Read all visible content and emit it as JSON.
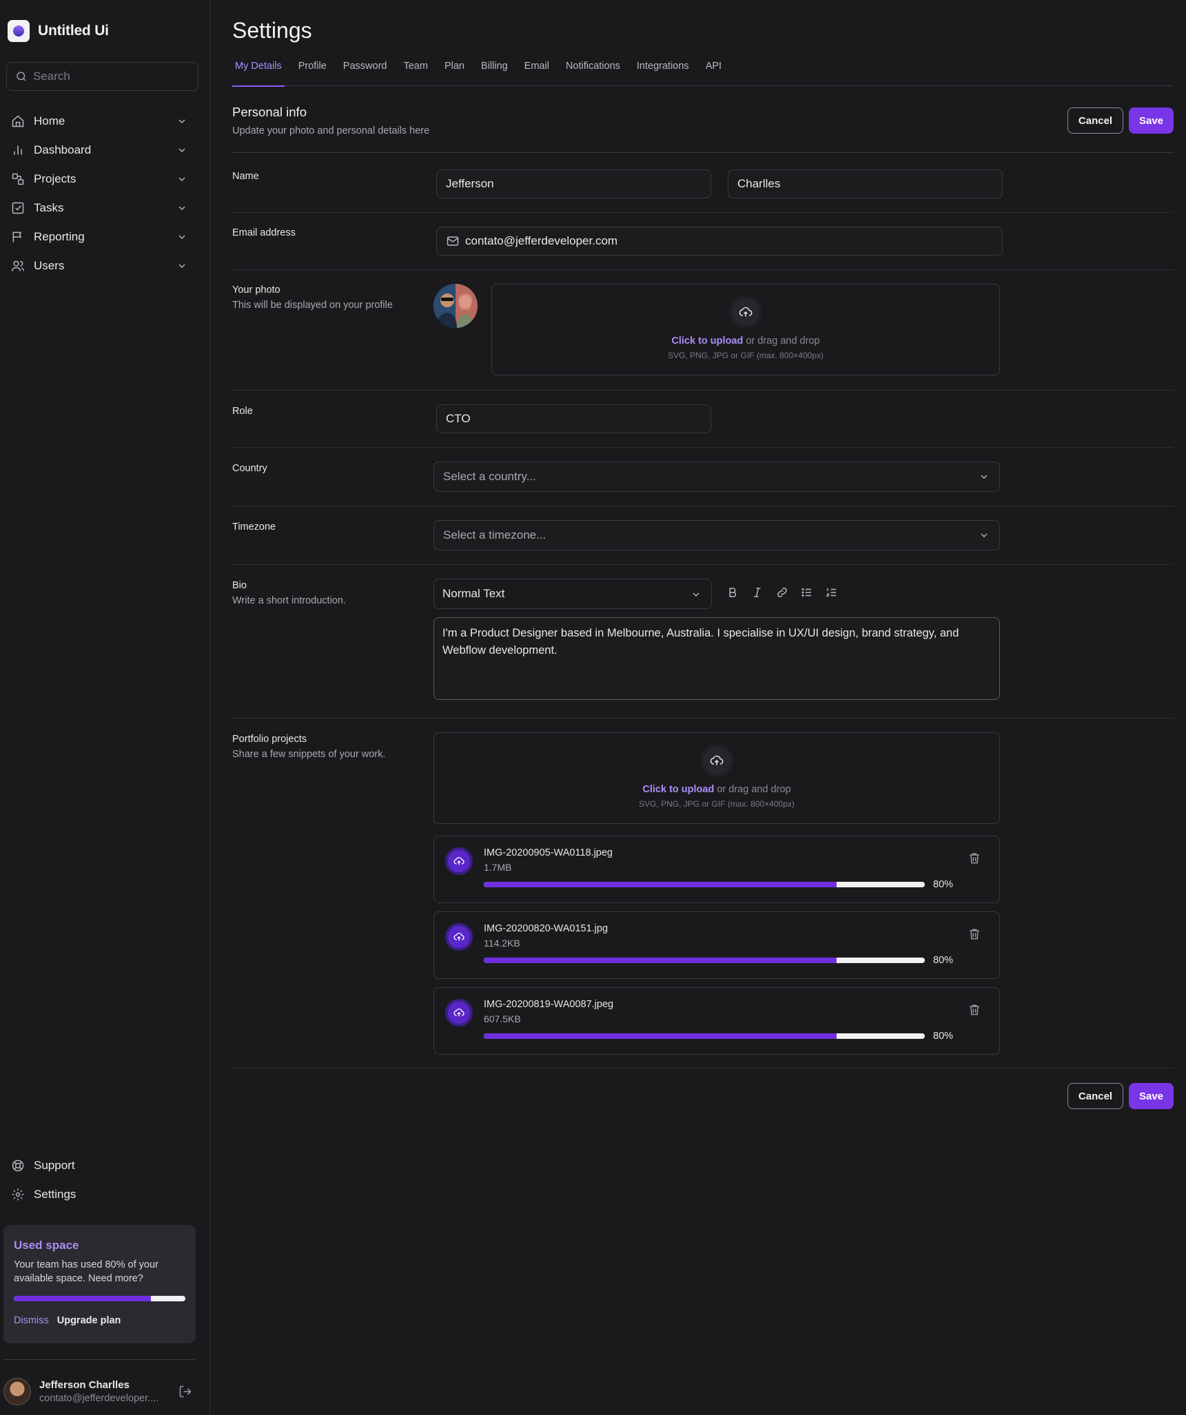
{
  "app": {
    "name": "Untitled Ui"
  },
  "search": {
    "placeholder": "Search"
  },
  "sidebar": {
    "items": [
      {
        "label": "Home",
        "icon": "home-icon"
      },
      {
        "label": "Dashboard",
        "icon": "bar-chart-icon"
      },
      {
        "label": "Projects",
        "icon": "layers-icon"
      },
      {
        "label": "Tasks",
        "icon": "check-square-icon"
      },
      {
        "label": "Reporting",
        "icon": "flag-icon"
      },
      {
        "label": "Users",
        "icon": "users-icon"
      }
    ],
    "bottom": [
      {
        "label": "Support",
        "icon": "lifebuoy-icon"
      },
      {
        "label": "Settings",
        "icon": "gear-icon"
      }
    ]
  },
  "used_space": {
    "title": "Used space",
    "text": "Your team has used 80% of your available space. Need more?",
    "progress": 0.8,
    "dismiss": "Dismiss",
    "upgrade": "Upgrade plan"
  },
  "user": {
    "name": "Jefferson Charlles",
    "email": "contato@jefferdeveloper...."
  },
  "page": {
    "title": "Settings"
  },
  "tabs": [
    "My Details",
    "Profile",
    "Password",
    "Team",
    "Plan",
    "Billing",
    "Email",
    "Notifications",
    "Integrations",
    "API"
  ],
  "personal": {
    "title": "Personal info",
    "subtitle": "Update your photo and personal details here",
    "cancel": "Cancel",
    "save": "Save"
  },
  "form": {
    "name_label": "Name",
    "first_name": "Jefferson",
    "last_name": "Charlles",
    "email_label": "Email address",
    "email": "contato@jefferdeveloper.com",
    "photo_label": "Your photo",
    "photo_sub": "This will be displayed on your profile",
    "upload_cta": "Click to upload",
    "upload_rest": " or drag and drop",
    "upload_hint": "SVG, PNG, JPG or GIF (max. 800×400px)",
    "role_label": "Role",
    "role": "CTO",
    "country_label": "Country",
    "country_placeholder": "Select a country...",
    "timezone_label": "Timezone",
    "timezone_placeholder": "Select a timezone...",
    "bio_label": "Bio",
    "bio_sub": "Write a short introduction.",
    "bio_format": "Normal Text",
    "bio": "I'm a Product Designer based in Melbourne, Australia. I specialise in UX/UI design, brand strategy, and Webflow development.",
    "portfolio_label": "Portfolio projects",
    "portfolio_sub": "Share a few snippets of your work."
  },
  "files": [
    {
      "name": "IMG-20200905-WA0118.jpeg",
      "size": "1.7MB",
      "progress": 0.8,
      "pct": "80%"
    },
    {
      "name": "IMG-20200820-WA0151.jpg",
      "size": "114.2KB",
      "progress": 0.8,
      "pct": "80%"
    },
    {
      "name": "IMG-20200819-WA0087.jpeg",
      "size": "607.5KB",
      "progress": 0.8,
      "pct": "80%"
    }
  ],
  "footer": {
    "cancel": "Cancel",
    "save": "Save"
  },
  "colors": {
    "accent": "#7a36e6",
    "accent_text": "#a98ef5",
    "background": "#1a1a1d"
  }
}
